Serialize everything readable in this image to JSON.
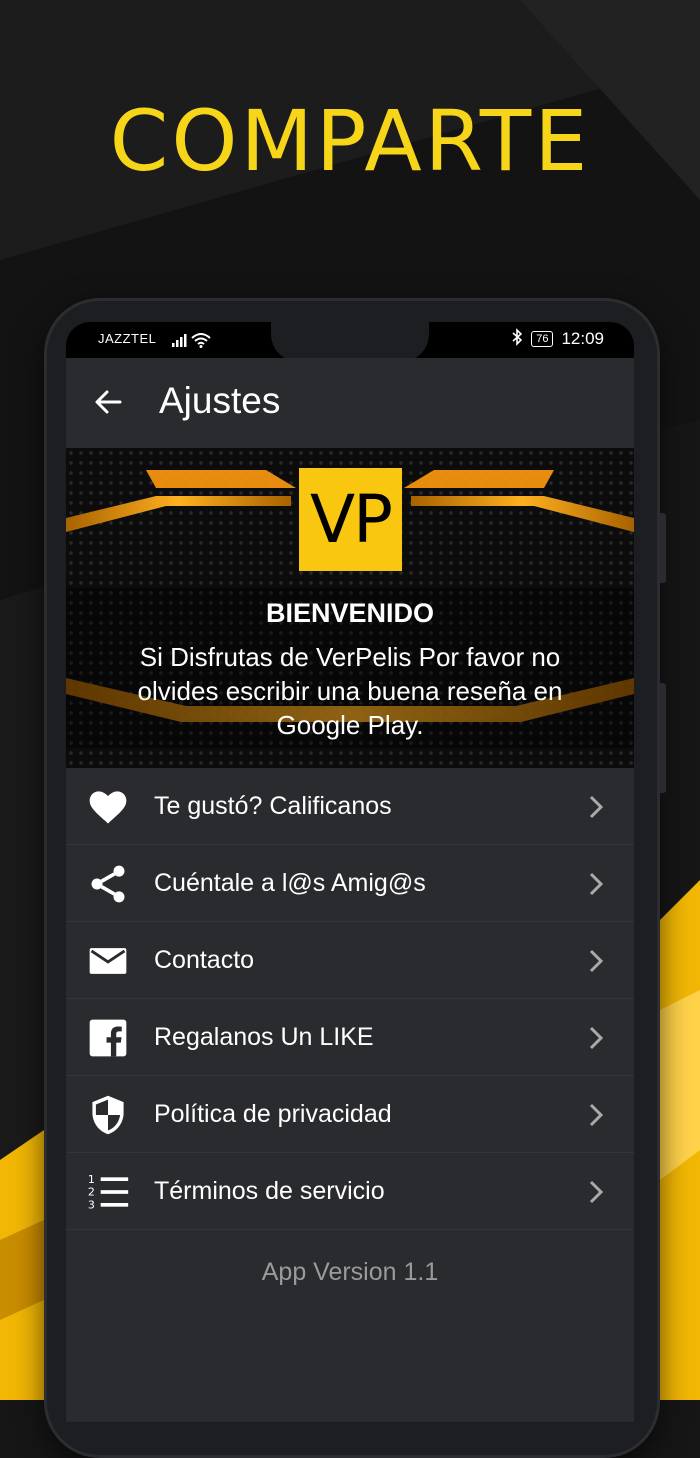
{
  "headline": "COMPARTE",
  "status_bar": {
    "carrier": "JAZZTEL",
    "battery": "76",
    "time": "12:09",
    "icons": [
      "signal-icon",
      "wifi-icon",
      "bluetooth-icon",
      "battery-icon"
    ]
  },
  "app_bar": {
    "title": "Ajustes",
    "back_icon": "arrow-left-icon"
  },
  "banner": {
    "logo": "VP",
    "welcome": "BIENVENIDO",
    "message": "Si Disfrutas de VerPelis Por favor no olvides escribir una buena reseña en Google Play."
  },
  "menu": {
    "items": [
      {
        "label": "Te gustó? Calificanos",
        "icon": "heart-icon"
      },
      {
        "label": "Cuéntale a l@s Amig@s",
        "icon": "share-icon"
      },
      {
        "label": "Contacto",
        "icon": "mail-icon"
      },
      {
        "label": "Regalanos Un LIKE",
        "icon": "facebook-icon"
      },
      {
        "label": "Política de privacidad",
        "icon": "shield-icon"
      },
      {
        "label": "Términos de servicio",
        "icon": "numbered-list-icon"
      }
    ]
  },
  "footer": {
    "version": "App Version 1.1"
  },
  "colors": {
    "accent": "#f7d61a",
    "logo_bg": "#f9c710",
    "background": "#161616",
    "screen_bg": "#2a2b2f"
  }
}
